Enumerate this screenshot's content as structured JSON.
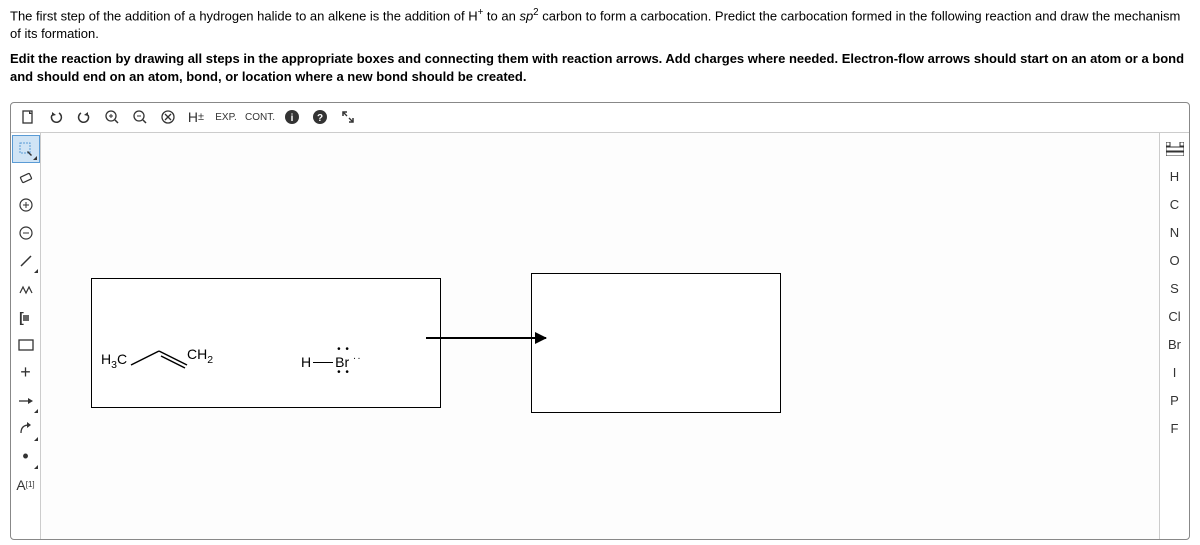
{
  "instructions": {
    "p1_before": "The first step of the addition of a hydrogen halide to an alkene is the addition of ",
    "p1_hplus": "H",
    "p1_plus": "+",
    "p1_mid": " to an ",
    "p1_sp": "sp",
    "p1_sp_sup": "2",
    "p1_after": " carbon to form a carbocation. Predict the carbocation formed in the following reaction and draw the mechanism of its formation.",
    "p2": "Edit the reaction by drawing all steps in the appropriate boxes and connecting them with reaction arrows. Add charges where needed. Electron-flow arrows should start on an atom or a bond and should end on an atom, bond, or location where a new bond should be created."
  },
  "toolbar_top": {
    "hlabel": "H",
    "hplusminus": "±",
    "exp": "EXP.",
    "cont": "CONT."
  },
  "left_tools": {
    "eraser": "◇",
    "plus_circle": "⊕",
    "minus_circle": "⊖",
    "single_bond": "╱",
    "wavy": "∿",
    "bracket": "[",
    "rect": "▭",
    "plus": "+",
    "arrow_sm": "→",
    "curved": "↷",
    "dot": "•",
    "atom_label": "A",
    "atom_sup": "[1]"
  },
  "right_tools": {
    "periodic": "⊞",
    "h": "H",
    "c": "C",
    "n": "N",
    "o": "O",
    "s": "S",
    "cl": "Cl",
    "br": "Br",
    "i": "I",
    "p": "P",
    "f": "F"
  },
  "molecules": {
    "h3c": "H₃C",
    "ch2": "CH₂",
    "h": "H",
    "br": "Br",
    "dash": "—",
    "equals": "═"
  }
}
